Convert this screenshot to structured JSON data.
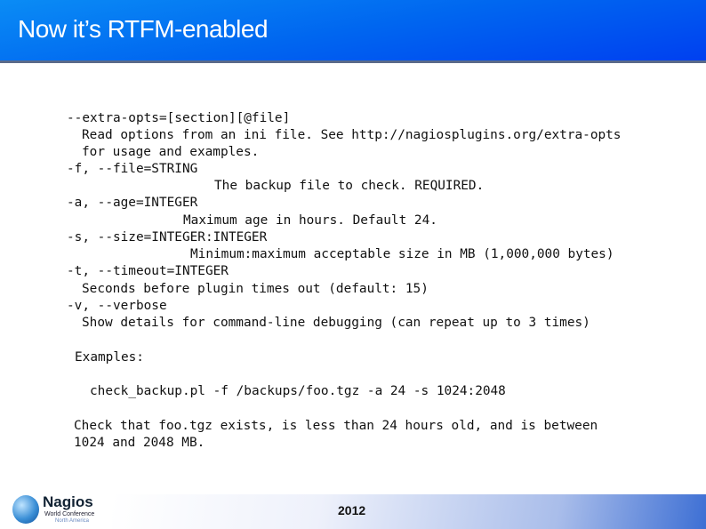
{
  "title": "Now it’s RTFM-enabled",
  "lines": [
    "--extra-opts=[section][@file]",
    "Read options from an ini file. See http://nagiosplugins.org/extra-opts",
    "for usage and examples.",
    "-f, --file=STRING",
    "The backup file to check. REQUIRED.",
    "-a, --age=INTEGER",
    "Maximum age in hours. Default 24.",
    "-s, --size=INTEGER:INTEGER",
    "Minimum:maximum acceptable size in MB (1,000,000 bytes)",
    "-t, --timeout=INTEGER",
    "Seconds before plugin times out (default: 15)",
    "-v, --verbose",
    "Show details for command-line debugging (can repeat up to 3 times)",
    "Examples:",
    "check_backup.pl -f /backups/foo.tgz -a 24 -s 1024:2048",
    "Check that foo.tgz exists, is less than 24 hours old, and is between",
    "1024 and 2048 MB."
  ],
  "footer": {
    "year": "2012",
    "logo": {
      "name": "Nagios",
      "line2": "World Conference",
      "line3": "North America"
    }
  }
}
